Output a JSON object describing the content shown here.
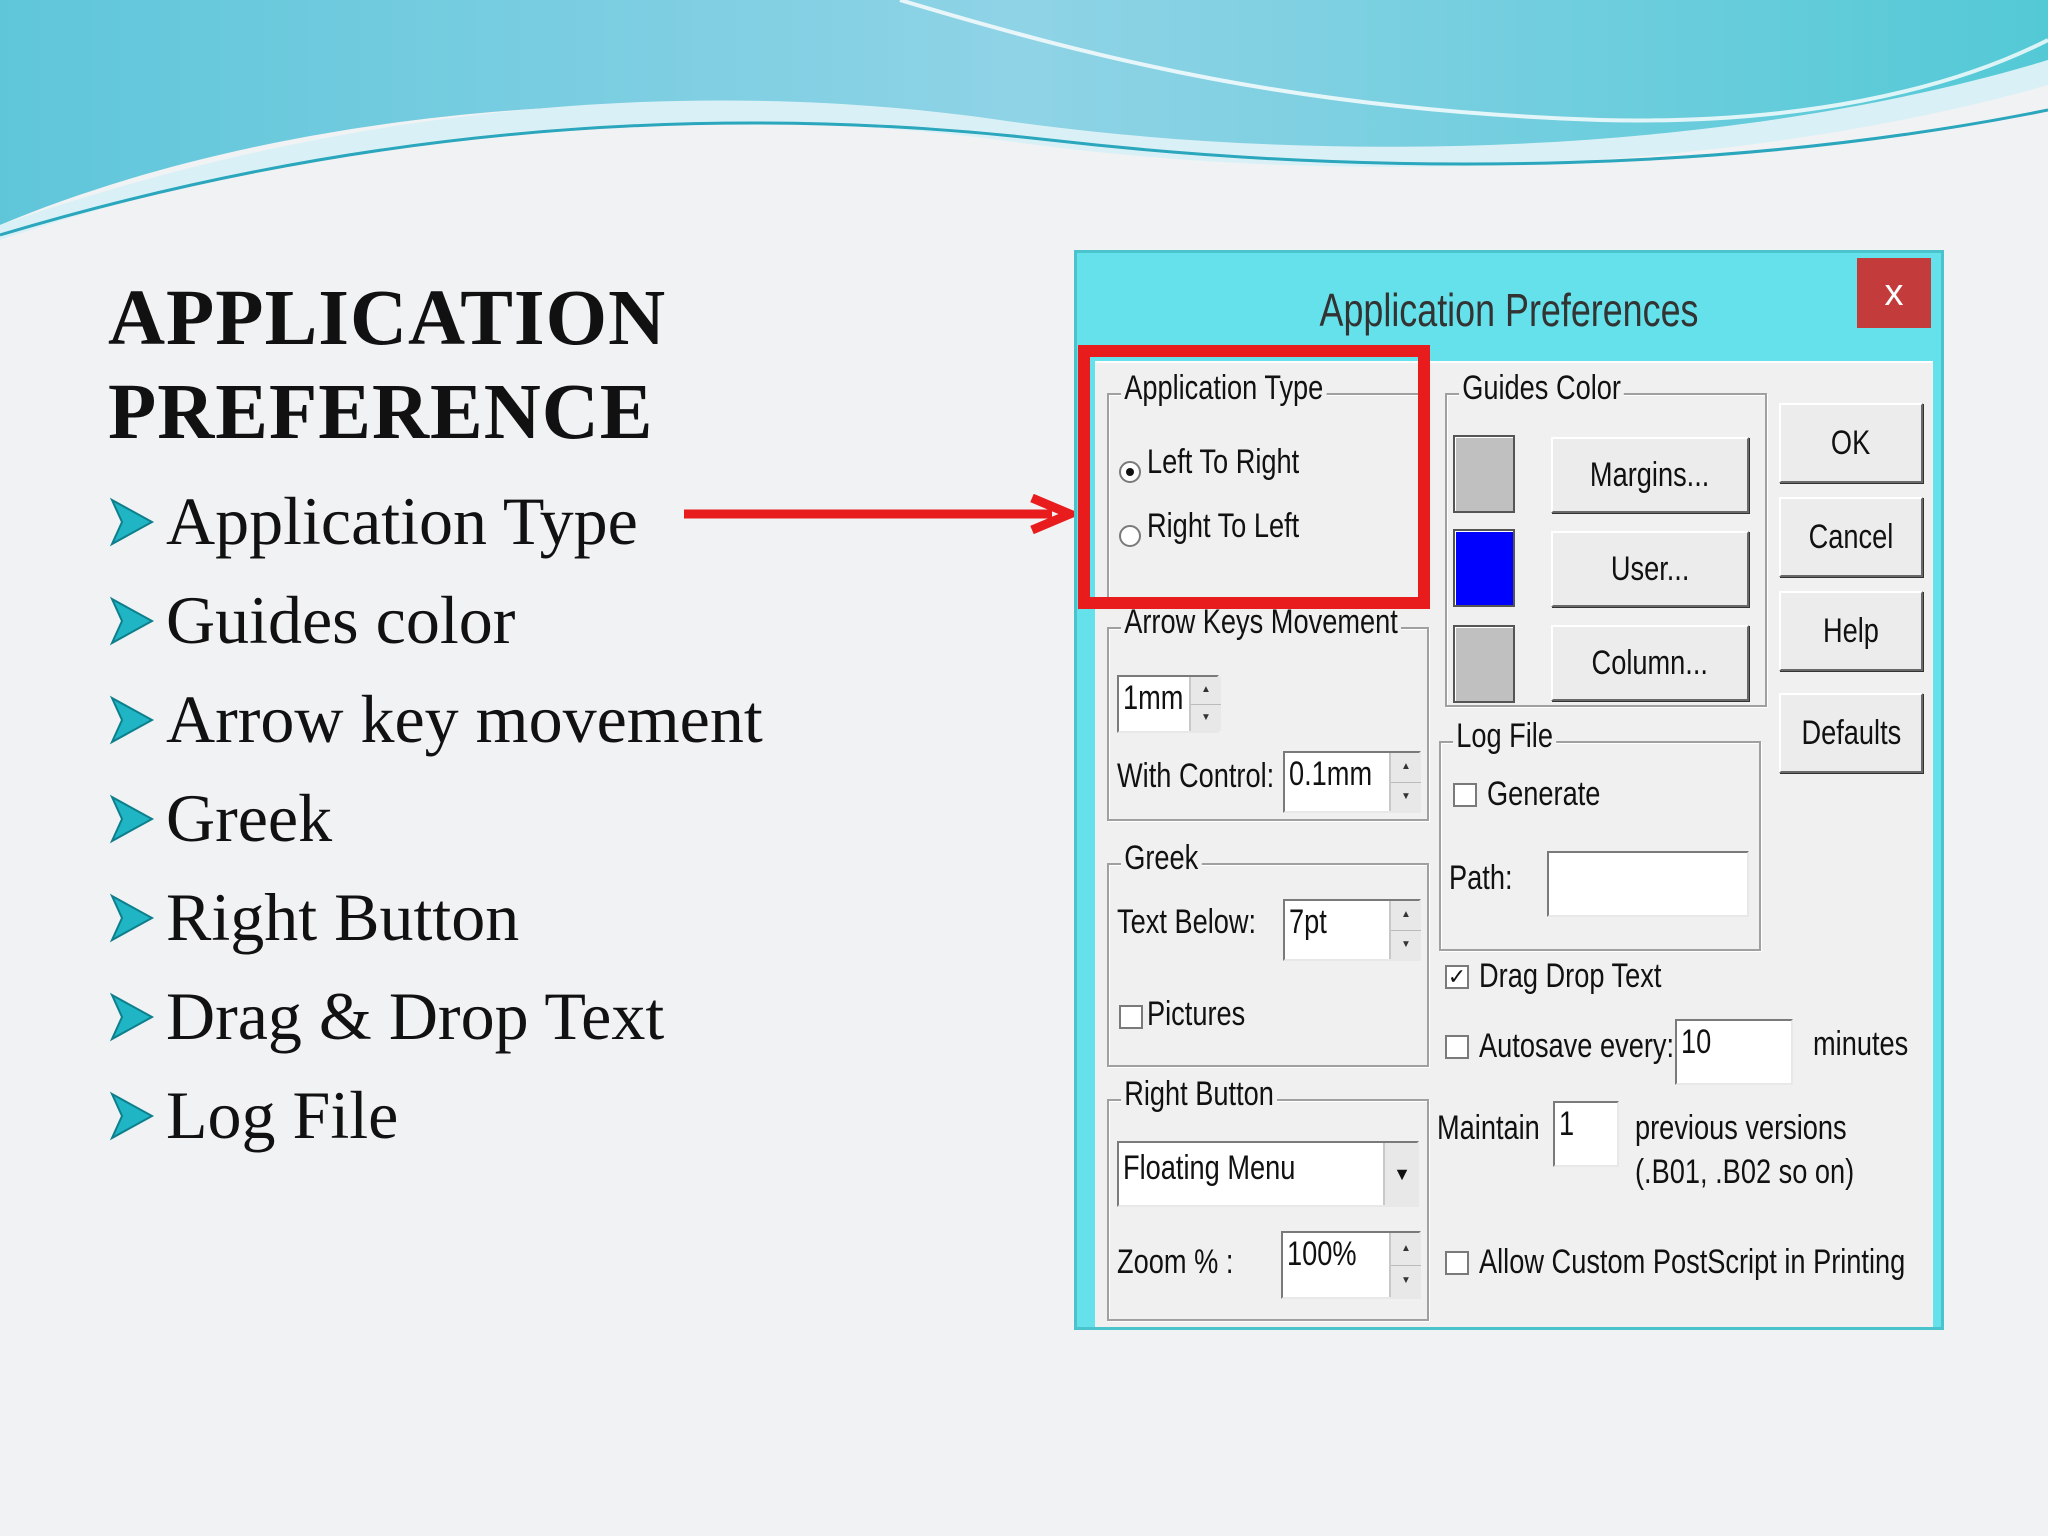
{
  "slide": {
    "title_line1": "APPLICATION",
    "title_line2": "PREFERENCE",
    "bullets": [
      "Application Type",
      "Guides color",
      "Arrow key movement",
      "Greek",
      "Right Button",
      "Drag & Drop Text",
      "Log File"
    ],
    "accent_color": "#1fb5c5",
    "callout_color": "#e81c1c"
  },
  "dialog": {
    "title": "Application Preferences",
    "close_label": "x",
    "application_type": {
      "label": "Application Type",
      "options": [
        "Left To Right",
        "Right To Left"
      ],
      "selected": "Left To Right"
    },
    "arrow_keys": {
      "label": "Arrow Keys Movement",
      "value": "1mm",
      "with_control_label": "With Control:",
      "with_control_value": "0.1mm"
    },
    "greek": {
      "label": "Greek",
      "text_below_label": "Text Below:",
      "text_below_value": "7pt",
      "pictures_label": "Pictures",
      "pictures_checked": false
    },
    "right_button": {
      "label": "Right Button",
      "selected": "Floating Menu",
      "zoom_label": "Zoom % :",
      "zoom_value": "100%"
    },
    "guides_color": {
      "label": "Guides Color",
      "buttons": [
        "Margins...",
        "User...",
        "Column..."
      ],
      "colors": [
        "#c0c0c0",
        "#0000ff",
        "#c0c0c0"
      ]
    },
    "log_file": {
      "label": "Log File",
      "generate_label": "Generate",
      "generate_checked": false,
      "path_label": "Path:",
      "path_value": ""
    },
    "drag_drop_label": "Drag Drop Text",
    "drag_drop_checked": true,
    "autosave": {
      "label": "Autosave every:",
      "value": "10",
      "unit": "minutes",
      "checked": false
    },
    "maintain": {
      "label": "Maintain",
      "value": "1",
      "suffix_line1": "previous versions",
      "suffix_line2": "(.B01, .B02 so on)"
    },
    "postscript_label": "Allow Custom PostScript in Printing",
    "postscript_checked": false,
    "buttons": {
      "ok": "OK",
      "cancel": "Cancel",
      "help": "Help",
      "defaults": "Defaults"
    }
  }
}
